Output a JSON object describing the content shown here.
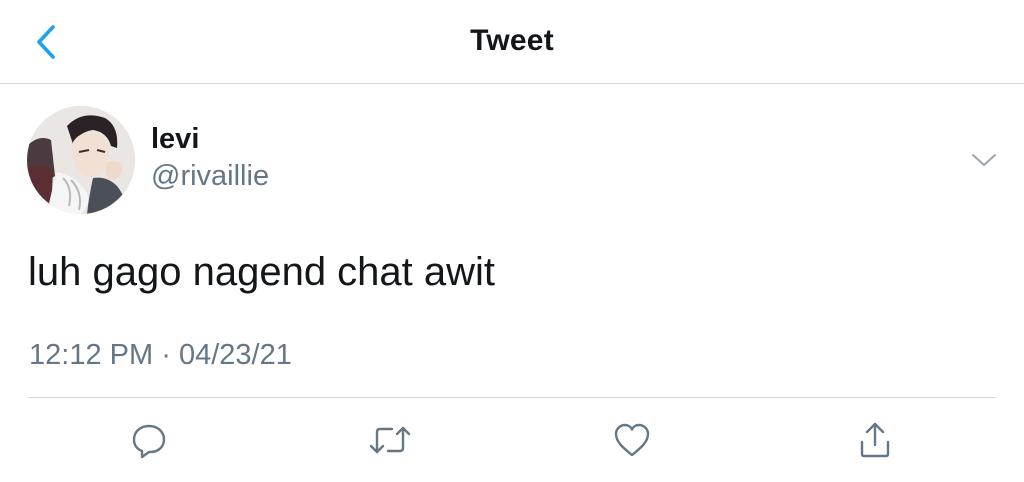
{
  "header": {
    "title": "Tweet",
    "back_icon": "chevron-left-icon"
  },
  "tweet": {
    "author": {
      "display_name": "levi",
      "handle": "@rivaillie"
    },
    "text": "luh gago nagend chat awit",
    "time": "12:12 PM",
    "separator": "·",
    "date": "04/23/21",
    "more_icon": "chevron-down-icon"
  },
  "actions": [
    {
      "name": "reply",
      "icon": "reply-icon"
    },
    {
      "name": "retweet",
      "icon": "retweet-icon"
    },
    {
      "name": "like",
      "icon": "heart-icon"
    },
    {
      "name": "share",
      "icon": "share-icon"
    }
  ],
  "colors": {
    "accent": "#1da1f2",
    "text": "#14171a",
    "secondary": "#657786",
    "divider": "#d6d9dc"
  }
}
